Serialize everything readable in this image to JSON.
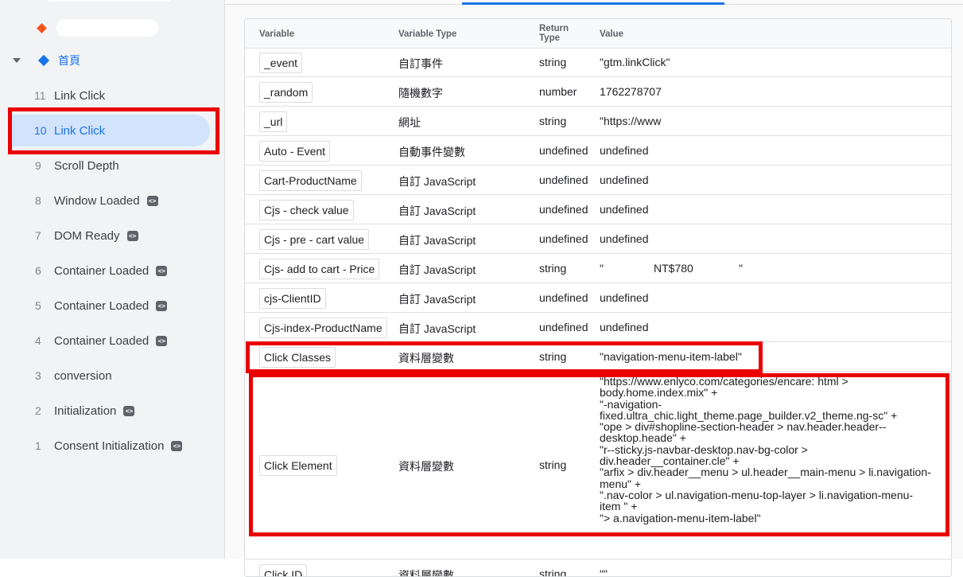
{
  "sidebar": {
    "home_label": "首頁",
    "events": [
      {
        "num": "11",
        "label": "Link Click",
        "code": false,
        "selected": false
      },
      {
        "num": "10",
        "label": "Link Click",
        "code": false,
        "selected": true
      },
      {
        "num": "9",
        "label": "Scroll Depth",
        "code": false,
        "selected": false
      },
      {
        "num": "8",
        "label": "Window Loaded",
        "code": true,
        "selected": false
      },
      {
        "num": "7",
        "label": "DOM Ready",
        "code": true,
        "selected": false
      },
      {
        "num": "6",
        "label": "Container Loaded",
        "code": true,
        "selected": false
      },
      {
        "num": "5",
        "label": "Container Loaded",
        "code": true,
        "selected": false
      },
      {
        "num": "4",
        "label": "Container Loaded",
        "code": true,
        "selected": false
      },
      {
        "num": "3",
        "label": "conversion",
        "code": false,
        "selected": false
      },
      {
        "num": "2",
        "label": "Initialization",
        "code": true,
        "selected": false
      },
      {
        "num": "1",
        "label": "Consent Initialization",
        "code": true,
        "selected": false
      }
    ],
    "code_glyph": "<>"
  },
  "table": {
    "headers": {
      "variable": "Variable",
      "variable_type": "Variable Type",
      "return_type_line1": "Return",
      "return_type_line2": "Type",
      "value": "Value"
    },
    "rows": [
      {
        "variable": "_event",
        "type": "自訂事件",
        "return": "string",
        "value": "\"gtm.linkClick\""
      },
      {
        "variable": "_random",
        "type": "隨機數字",
        "return": "number",
        "value": "1762278707"
      },
      {
        "variable": "_url",
        "type": "網址",
        "return": "string",
        "value": "\"https://www"
      },
      {
        "variable": "Auto - Event",
        "type": "自動事件變數",
        "return": "undefined",
        "value": "undefined"
      },
      {
        "variable": "Cart-ProductName",
        "type": "自訂 JavaScript",
        "return": "undefined",
        "value": "undefined"
      },
      {
        "variable": "Cjs - check value",
        "type": "自訂 JavaScript",
        "return": "undefined",
        "value": "undefined"
      },
      {
        "variable": "Cjs - pre - cart value",
        "type": "自訂 JavaScript",
        "return": "undefined",
        "value": "undefined"
      },
      {
        "variable": "Cjs- add to cart - Price",
        "type": "自訂 JavaScript",
        "return": "string",
        "value_parts": [
          "\"",
          "NT$780",
          "\""
        ]
      },
      {
        "variable": "cjs-ClientID",
        "type": "自訂 JavaScript",
        "return": "undefined",
        "value": "undefined"
      },
      {
        "variable": "Cjs-index-ProductName",
        "type": "自訂 JavaScript",
        "return": "undefined",
        "value": "undefined"
      },
      {
        "variable": "Click Classes",
        "type": "資料層變數",
        "return": "string",
        "value": "\"navigation-menu-item-label\""
      },
      {
        "variable": "Click Element",
        "type": "資料層變數",
        "return": "string",
        "value_lines": [
          "\"https://www.enlyco.com/categories/encare: html >",
          "body.home.index.mix\" +",
          "\"-navigation-",
          "fixed.ultra_chic.light_theme.page_builder.v2_theme.ng-sc\" +",
          "\"ope > div#shopline-section-header > nav.header.header--",
          "desktop.heade\" +",
          "\"r--sticky.js-navbar-desktop.nav-bg-color >",
          "div.header__container.cle\" +",
          "\"arfix > div.header__menu > ul.header__main-menu > li.navigation-",
          "menu\" +",
          "\".nav-color > ul.navigation-menu-top-layer > li.navigation-menu-",
          "item \" +",
          "\"> a.navigation-menu-item-label\""
        ]
      },
      {
        "variable": "Click ID",
        "type": "資料層變數",
        "return": "string",
        "value": "\"\""
      }
    ]
  }
}
